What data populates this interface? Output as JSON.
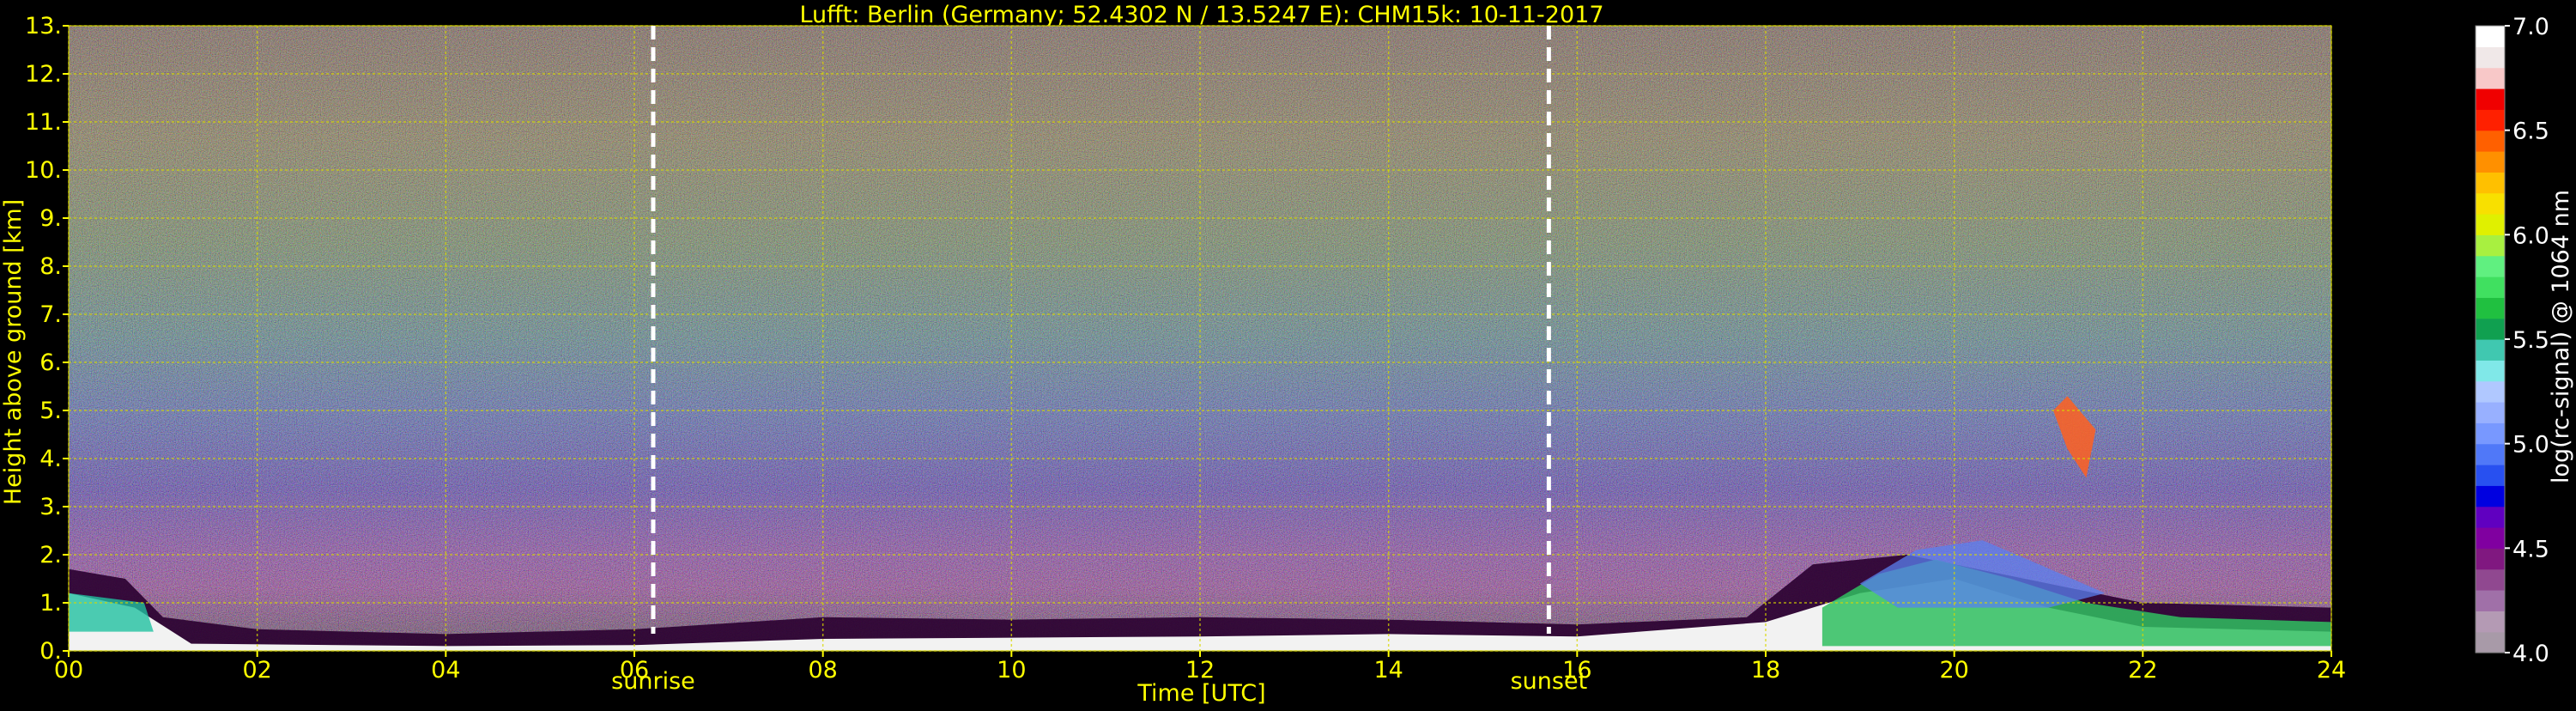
{
  "chart_data": {
    "type": "heatmap",
    "title": "Lufft: Berlin (Germany; 52.4302 N / 13.5247 E):    CHM15k: 10-11-2017",
    "xlabel": "Time [UTC]",
    "ylabel": "Height above ground [km]",
    "xlim": [
      0,
      24
    ],
    "ylim": [
      0,
      13
    ],
    "x_ticks": [
      {
        "value": 0,
        "label": "00"
      },
      {
        "value": 2,
        "label": "02"
      },
      {
        "value": 4,
        "label": "04"
      },
      {
        "value": 6,
        "label": "06"
      },
      {
        "value": 8,
        "label": "08"
      },
      {
        "value": 10,
        "label": "10"
      },
      {
        "value": 12,
        "label": "12"
      },
      {
        "value": 14,
        "label": "14"
      },
      {
        "value": 16,
        "label": "16"
      },
      {
        "value": 18,
        "label": "18"
      },
      {
        "value": 20,
        "label": "20"
      },
      {
        "value": 22,
        "label": "22"
      },
      {
        "value": 24,
        "label": "24"
      }
    ],
    "y_ticks": [
      {
        "value": 0,
        "label": "0."
      },
      {
        "value": 1,
        "label": "1."
      },
      {
        "value": 2,
        "label": "2."
      },
      {
        "value": 3,
        "label": "3."
      },
      {
        "value": 4,
        "label": "4."
      },
      {
        "value": 5,
        "label": "5."
      },
      {
        "value": 6,
        "label": "6."
      },
      {
        "value": 7,
        "label": "7."
      },
      {
        "value": 8,
        "label": "8."
      },
      {
        "value": 9,
        "label": "9."
      },
      {
        "value": 10,
        "label": "10."
      },
      {
        "value": 11,
        "label": "11."
      },
      {
        "value": 12,
        "label": "12."
      },
      {
        "value": 13,
        "label": "13."
      }
    ],
    "grid": true,
    "markers": [
      {
        "x": 6.2,
        "label": "sunrise"
      },
      {
        "x": 15.7,
        "label": "sunset"
      }
    ],
    "colorbar": {
      "label": "log(rc-signal) @ 1064 nm",
      "range": [
        4.0,
        7.0
      ],
      "ticks": [
        {
          "value": 4.0,
          "label": "4.0"
        },
        {
          "value": 4.5,
          "label": "4.5"
        },
        {
          "value": 5.0,
          "label": "5.0"
        },
        {
          "value": 5.5,
          "label": "5.5"
        },
        {
          "value": 6.0,
          "label": "6.0"
        },
        {
          "value": 6.5,
          "label": "6.5"
        },
        {
          "value": 7.0,
          "label": "7.0"
        }
      ],
      "colors": [
        "#a89aa8",
        "#b49ab4",
        "#a070a8",
        "#904890",
        "#801880",
        "#8000a0",
        "#6000c0",
        "#0000e0",
        "#2850f0",
        "#5078f8",
        "#7898ff",
        "#98b0ff",
        "#b0c8ff",
        "#80e8e8",
        "#40c8b0",
        "#10a050",
        "#20c040",
        "#40e060",
        "#60f080",
        "#a8f040",
        "#e0f000",
        "#f8e000",
        "#ffc000",
        "#ff9000",
        "#ff6000",
        "#ff2000",
        "#f00000",
        "#f8c8c8",
        "#f0e8e8",
        "#ffffff"
      ]
    },
    "colors": {
      "background": "#000000",
      "label_text": "#ffff00",
      "grid": "#d8d800",
      "markers": "#ffffff",
      "colorbar_text": "#ffffff"
    }
  }
}
